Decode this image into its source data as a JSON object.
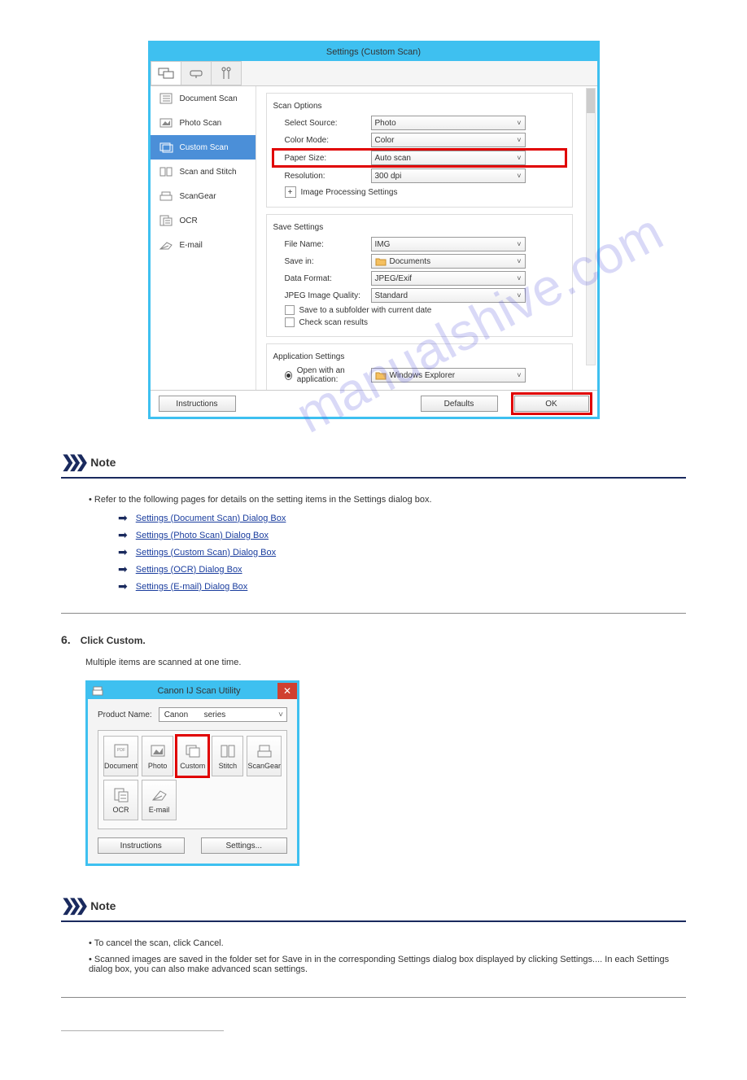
{
  "dialog1": {
    "title": "Settings (Custom Scan)",
    "sidebar": {
      "items": [
        {
          "label": "Document Scan"
        },
        {
          "label": "Photo Scan"
        },
        {
          "label": "Custom Scan"
        },
        {
          "label": "Scan and Stitch"
        },
        {
          "label": "ScanGear"
        },
        {
          "label": "OCR"
        },
        {
          "label": "E-mail"
        }
      ]
    },
    "scan_options": {
      "heading": "Scan Options",
      "select_source_label": "Select Source:",
      "select_source_value": "Photo",
      "color_mode_label": "Color Mode:",
      "color_mode_value": "Color",
      "paper_size_label": "Paper Size:",
      "paper_size_value": "Auto scan",
      "resolution_label": "Resolution:",
      "resolution_value": "300 dpi",
      "image_processing_label": "Image Processing Settings"
    },
    "save_settings": {
      "heading": "Save Settings",
      "file_name_label": "File Name:",
      "file_name_value": "IMG",
      "save_in_label": "Save in:",
      "save_in_value": "Documents",
      "data_format_label": "Data Format:",
      "data_format_value": "JPEG/Exif",
      "jpeg_quality_label": "JPEG Image Quality:",
      "jpeg_quality_value": "Standard",
      "subfolder_label": "Save to a subfolder with current date",
      "check_results_label": "Check scan results"
    },
    "app_settings": {
      "heading": "Application Settings",
      "open_with_label": "Open with an application:",
      "open_with_value": "Windows Explorer"
    },
    "footer": {
      "instructions": "Instructions",
      "defaults": "Defaults",
      "ok": "OK"
    }
  },
  "note1": {
    "label": "Note",
    "text": "Refer to the following pages for details on the setting items in the Settings dialog box.",
    "links": [
      "Settings (Document Scan) Dialog Box",
      "Settings (Photo Scan) Dialog Box",
      "Settings (Custom Scan) Dialog Box",
      "Settings (OCR) Dialog Box",
      "Settings (E-mail) Dialog Box"
    ]
  },
  "step6": {
    "num": "6.",
    "text": "Click Custom.",
    "sub": "Multiple items are scanned at one time."
  },
  "dialog2": {
    "title": "Canon IJ Scan Utility",
    "product_label": "Product Name:",
    "product_value_prefix": "Canon",
    "product_value_suffix": "series",
    "buttons_row1": [
      {
        "label": "Document"
      },
      {
        "label": "Photo"
      },
      {
        "label": "Custom"
      },
      {
        "label": "Stitch"
      },
      {
        "label": "ScanGear"
      }
    ],
    "buttons_row2": [
      {
        "label": "OCR"
      },
      {
        "label": "E-mail"
      }
    ],
    "footer": {
      "instructions": "Instructions",
      "settings": "Settings..."
    }
  },
  "note2": {
    "label": "Note",
    "bullet1": "To cancel the scan, click Cancel.",
    "bullet2": "Scanned images are saved in the folder set for Save in in the corresponding Settings dialog box displayed by clicking Settings.... In each Settings dialog box, you can also make advanced scan settings."
  },
  "watermark": "manualshive.com"
}
